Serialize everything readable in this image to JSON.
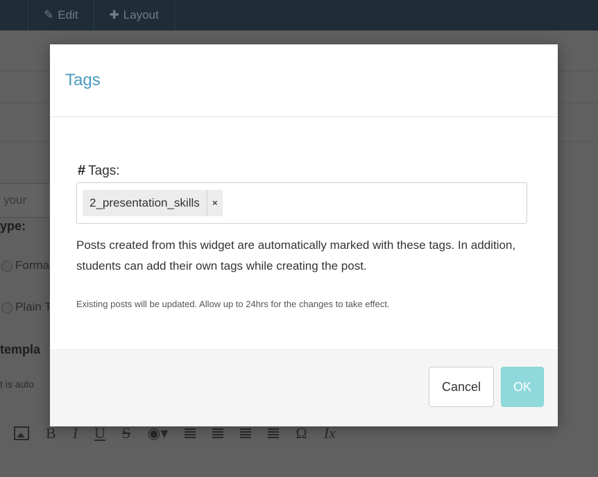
{
  "topbar": {
    "tabs": [
      {
        "label": "Edit",
        "icon": "pencil-icon"
      },
      {
        "label": "Layout",
        "icon": "move-icon"
      }
    ]
  },
  "background": {
    "input_placeholder": "e your",
    "type_label": "ype:",
    "radio_options": [
      "Forma",
      "Plain T"
    ],
    "template_label": "templa",
    "template_help": "t is auto",
    "toolbar_glyphs": {
      "bold": "B",
      "italic": "I",
      "underline": "U",
      "strike": "S",
      "omega": "Ω",
      "clear": "Ix"
    }
  },
  "modal": {
    "title": "Tags",
    "field_label": "Tags:",
    "tags": [
      {
        "label": "2_presentation_skills",
        "remove": "×"
      }
    ],
    "help_text": "Posts created from this widget are automatically marked with these tags. In addition, students can add their own tags while creating the post.",
    "note_text": "Existing posts will be updated. Allow up to 24hrs for the changes to take effect.",
    "cancel_label": "Cancel",
    "ok_label": "OK"
  },
  "colors": {
    "title": "#4a9bc1",
    "ok_button": "#8fd9dc",
    "topbar": "#1e2d36"
  }
}
